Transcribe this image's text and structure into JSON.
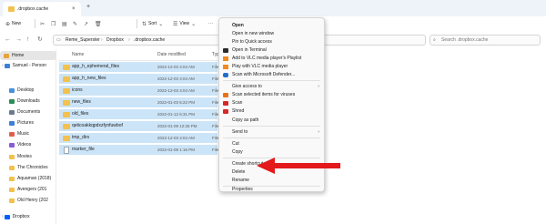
{
  "window": {
    "tab_title": ".dropbox.cache",
    "tab_close": "×",
    "new_tab": "+"
  },
  "toolbar": {
    "new_label": "New",
    "sort_label": "Sort",
    "view_label": "View",
    "more_label": "···"
  },
  "addressbar": {
    "crumbs": [
      "Reme_Superster",
      "Dropbox",
      ".dropbox.cache"
    ],
    "search_placeholder": "Search .dropbox.cache"
  },
  "sidebar": {
    "home": "Home",
    "user": "Samuel - Person",
    "items": [
      {
        "label": "Desktop",
        "color": "#4a90d9"
      },
      {
        "label": "Downloads",
        "color": "#2e8b57"
      },
      {
        "label": "Documents",
        "color": "#6b7b8c"
      },
      {
        "label": "Pictures",
        "color": "#3d7ed6"
      },
      {
        "label": "Music",
        "color": "#e35d4f"
      },
      {
        "label": "Videos",
        "color": "#8a5cd6"
      },
      {
        "label": "Movies",
        "color": "#f2c14e"
      },
      {
        "label": "The Chronicles",
        "color": "#f2c14e"
      },
      {
        "label": "Aquaman (2018)",
        "color": "#f2c14e"
      },
      {
        "label": "Avengers (201",
        "color": "#f2c14e"
      },
      {
        "label": "Old Henry (202",
        "color": "#f2c14e"
      }
    ],
    "dropbox": "Dropbox"
  },
  "columns": {
    "name": "Name",
    "date": "Date modified",
    "type": "Type"
  },
  "files": [
    {
      "name": "app_h_ephemeral_files",
      "date": "2022-12-03 4:04 AM",
      "type": "File fo",
      "kind": "folder"
    },
    {
      "name": "app_h_new_files",
      "date": "2022-12-03 4:04 AM",
      "type": "File fo",
      "kind": "folder"
    },
    {
      "name": "icons",
      "date": "2022-12-03 4:04 AM",
      "type": "File fo",
      "kind": "folder"
    },
    {
      "name": "new_files",
      "date": "2022-01-03 5:22 PM",
      "type": "File fo",
      "kind": "folder"
    },
    {
      "name": "old_files",
      "date": "2022-01-12 6:31 PM",
      "type": "File fo",
      "kind": "folder"
    },
    {
      "name": "qeticoakkqpdxzfynfuwbof",
      "date": "2022-01-09 12:26 PM",
      "type": "File fo",
      "kind": "folder"
    },
    {
      "name": "tmp_dirs",
      "date": "2022-12-03 4:04 AM",
      "type": "File fo",
      "kind": "folder"
    },
    {
      "name": "marker_file",
      "date": "2022-01-09 1:16 PM",
      "type": "File",
      "kind": "file"
    }
  ],
  "context_menu": {
    "open": "Open",
    "open_new_window": "Open in new window",
    "pin_quick_access": "Pin to Quick access",
    "open_terminal": "Open in Terminal",
    "vlc_playlist": "Add to VLC media player's Playlist",
    "vlc_play": "Play with VLC media player",
    "defender": "Scan with Microsoft Defender...",
    "give_access": "Give access to",
    "scan_viruses": "Scan selected items for viruses",
    "scan": "Scan",
    "shred": "Shred",
    "copy_path": "Copy as path",
    "send_to": "Send to",
    "cut": "Cut",
    "copy": "Copy",
    "create_shortcut": "Create shortcut",
    "delete": "Delete",
    "rename": "Rename",
    "properties": "Properties",
    "submenu_arrow": "›"
  },
  "colors": {
    "selection": "#cce4f7",
    "folder": "#f2c14e",
    "annotation_arrow": "#e3191b"
  }
}
